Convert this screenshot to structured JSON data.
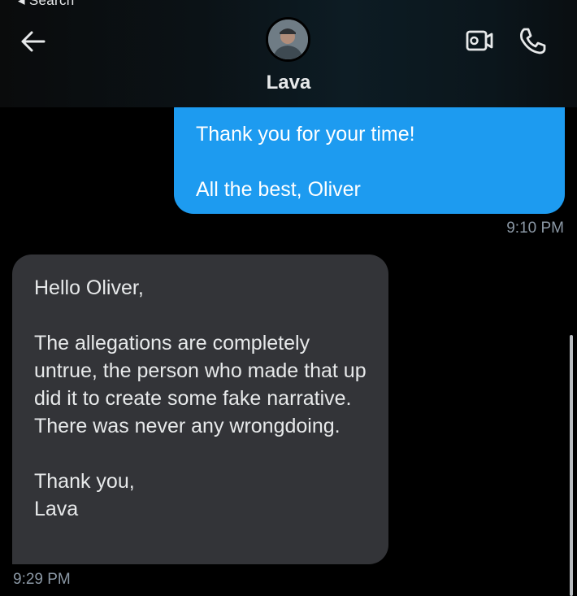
{
  "status_bar": {
    "back_label": "◂ Search"
  },
  "header": {
    "contact_name": "Lava"
  },
  "icons": {
    "back": "arrow-left-icon",
    "avatar": "avatar-photo",
    "video": "video-camera-icon",
    "phone": "phone-icon"
  },
  "messages": [
    {
      "direction": "sent",
      "text": "Thank you for your time!\n\nAll the best, Oliver",
      "time": "9:10 PM"
    },
    {
      "direction": "received",
      "text": "Hello Oliver,\n\nThe allegations are completely untrue, the person who made that up did it to create some fake narrative. There was never any wrongdoing.\n\nThank you,\nLava",
      "time": "9:29 PM"
    }
  ],
  "colors": {
    "background": "#000000",
    "sent_bubble": "#1d9bf0",
    "received_bubble": "#333438",
    "timestamp": "#8b98a5",
    "text": "#e7e9ea"
  }
}
